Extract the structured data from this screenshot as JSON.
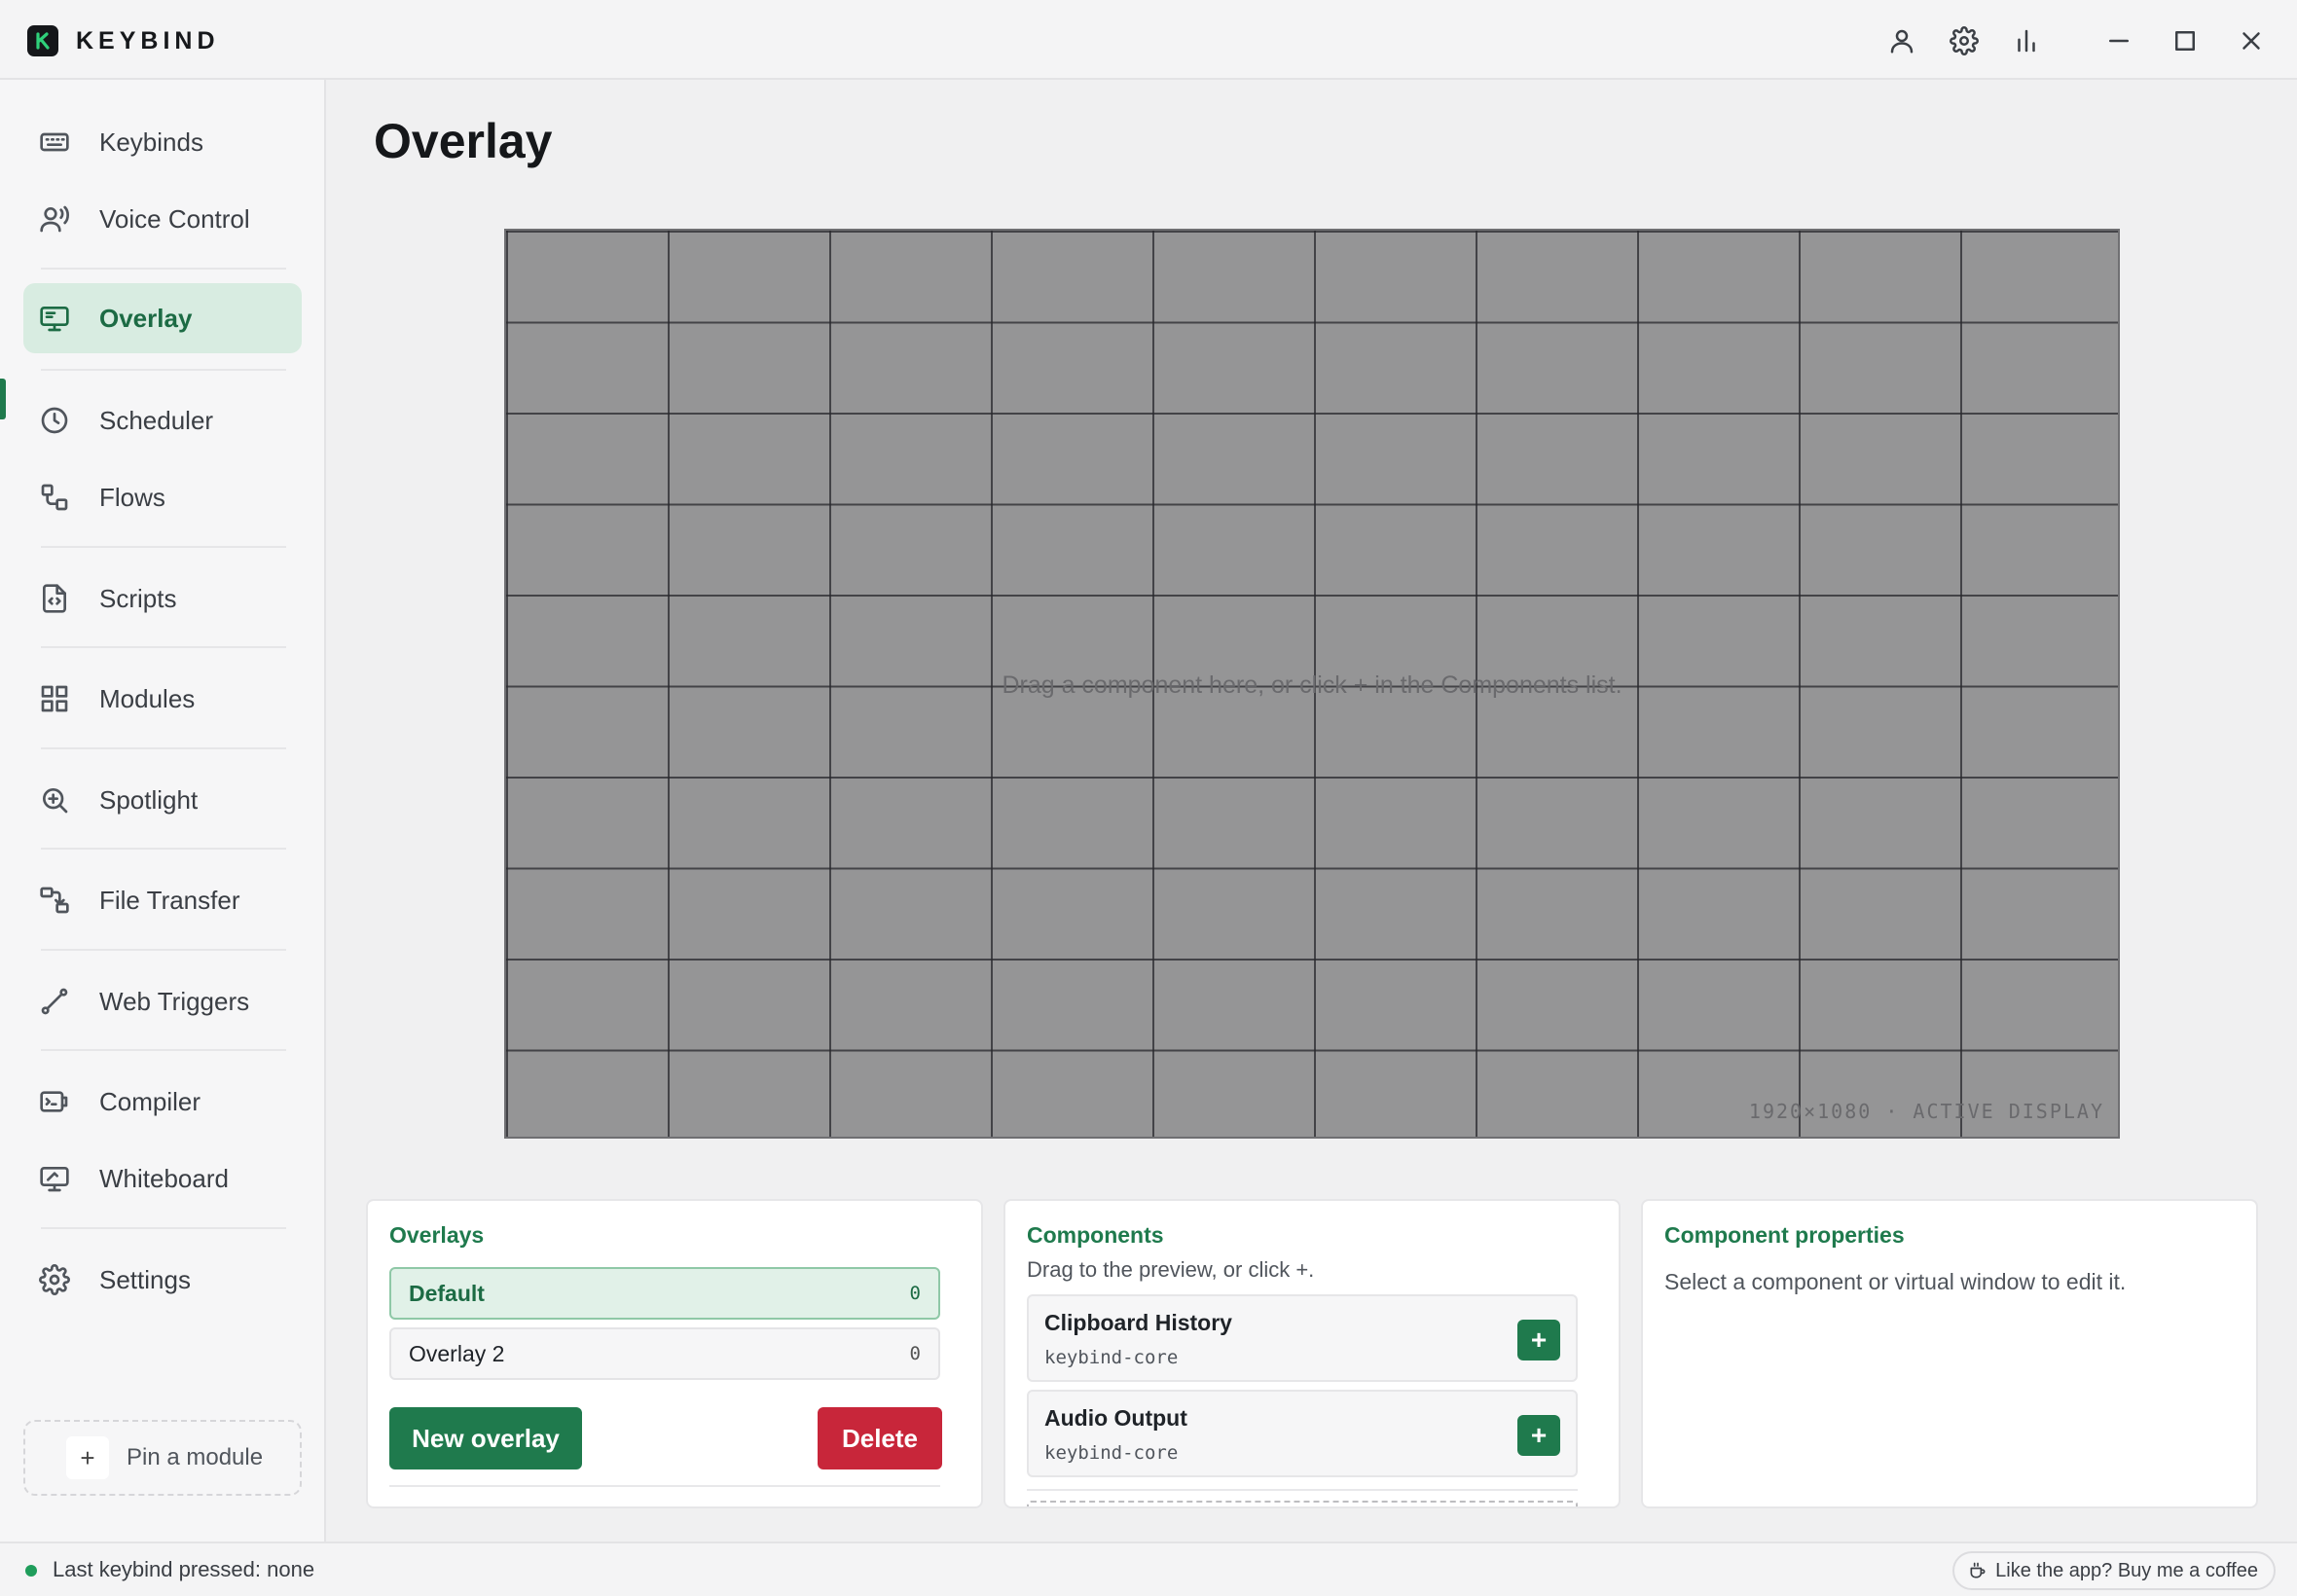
{
  "app": {
    "name": "KEYBIND",
    "logo_letter": "K",
    "accent_color": "#1f7a4d",
    "danger_color": "#c8263a"
  },
  "titlebar": {
    "icons": [
      "account-icon",
      "settings-icon",
      "stats-icon"
    ],
    "window_controls": [
      "minimize-icon",
      "maximize-icon",
      "close-icon"
    ]
  },
  "sidebar": {
    "items": [
      {
        "label": "Keybinds",
        "icon": "keyboard-icon"
      },
      {
        "label": "Voice Control",
        "icon": "voice-icon"
      },
      {
        "label": "Overlay",
        "icon": "monitor-icon",
        "active": true
      },
      {
        "label": "Scheduler",
        "icon": "clock-icon"
      },
      {
        "label": "Flows",
        "icon": "flow-icon"
      },
      {
        "label": "Scripts",
        "icon": "script-file-icon"
      },
      {
        "label": "Modules",
        "icon": "grid-icon"
      },
      {
        "label": "Spotlight",
        "icon": "search-zoom-icon"
      },
      {
        "label": "File Transfer",
        "icon": "file-transfer-icon"
      },
      {
        "label": "Web Triggers",
        "icon": "web-trigger-icon"
      },
      {
        "label": "Compiler",
        "icon": "compiler-icon"
      },
      {
        "label": "Whiteboard",
        "icon": "whiteboard-icon"
      },
      {
        "label": "Settings",
        "icon": "gear-icon"
      }
    ],
    "pin_label": "Pin a module",
    "pin_symbol": "+"
  },
  "main": {
    "title": "Overlay",
    "preview": {
      "hint": "Drag a component here, or click + in the Components list.",
      "resolution": "1920×1080 · ACTIVE DISPLAY"
    },
    "overlays_panel": {
      "title": "Overlays",
      "items": [
        {
          "name": "Default",
          "count": "0",
          "selected": true
        },
        {
          "name": "Overlay 2",
          "count": "0",
          "selected": false
        }
      ],
      "new_button": "New overlay",
      "delete_button": "Delete"
    },
    "components_panel": {
      "title": "Components",
      "subtitle": "Drag to the preview, or click +.",
      "items": [
        {
          "name": "Clipboard History",
          "source": "keybind-core",
          "add": "+"
        },
        {
          "name": "Audio Output",
          "source": "keybind-core",
          "add": "+"
        }
      ]
    },
    "properties_panel": {
      "title": "Component properties",
      "empty_text": "Select a component or virtual window to edit it."
    }
  },
  "statusbar": {
    "last_keybind": "Last keybind pressed: none",
    "coffee": "Like the app? Buy me a coffee"
  }
}
